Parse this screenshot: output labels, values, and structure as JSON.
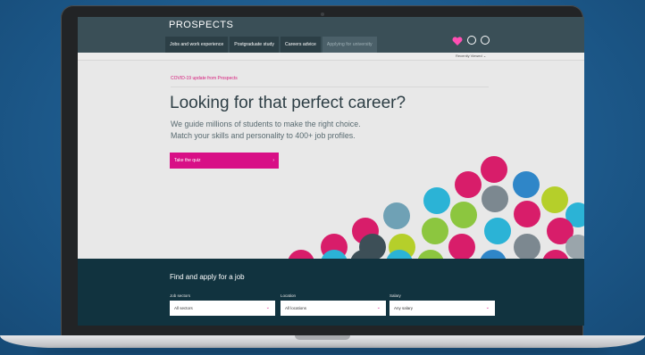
{
  "site": {
    "logo": "PROSPECTS",
    "nav": [
      {
        "label": "Jobs and work experience"
      },
      {
        "label": "Postgraduate study"
      },
      {
        "label": "Careers advice"
      },
      {
        "label": "Applying for university"
      }
    ],
    "recently_viewed": "Recently Viewed ⌄"
  },
  "hero": {
    "covid_link": "COVID-19 update from Prospects",
    "title": "Looking for that perfect career?",
    "subtitle_line1": "We guide millions of students to make the right choice.",
    "subtitle_line2": "Match your skills and personality to 400+ job profiles.",
    "quiz_button": "Take the quiz",
    "quiz_arrow": "›"
  },
  "finder": {
    "title": "Find and apply for a job",
    "fields": [
      {
        "label": "Job sectors",
        "value": "All sectors"
      },
      {
        "label": "Location",
        "value": "All locations"
      },
      {
        "label": "Salary",
        "value": "Any salary"
      }
    ],
    "chevron": "⌄"
  },
  "colors": {
    "brand_pink": "#d80f86",
    "header": "#3a4f57",
    "finder_bg": "#11333f"
  }
}
